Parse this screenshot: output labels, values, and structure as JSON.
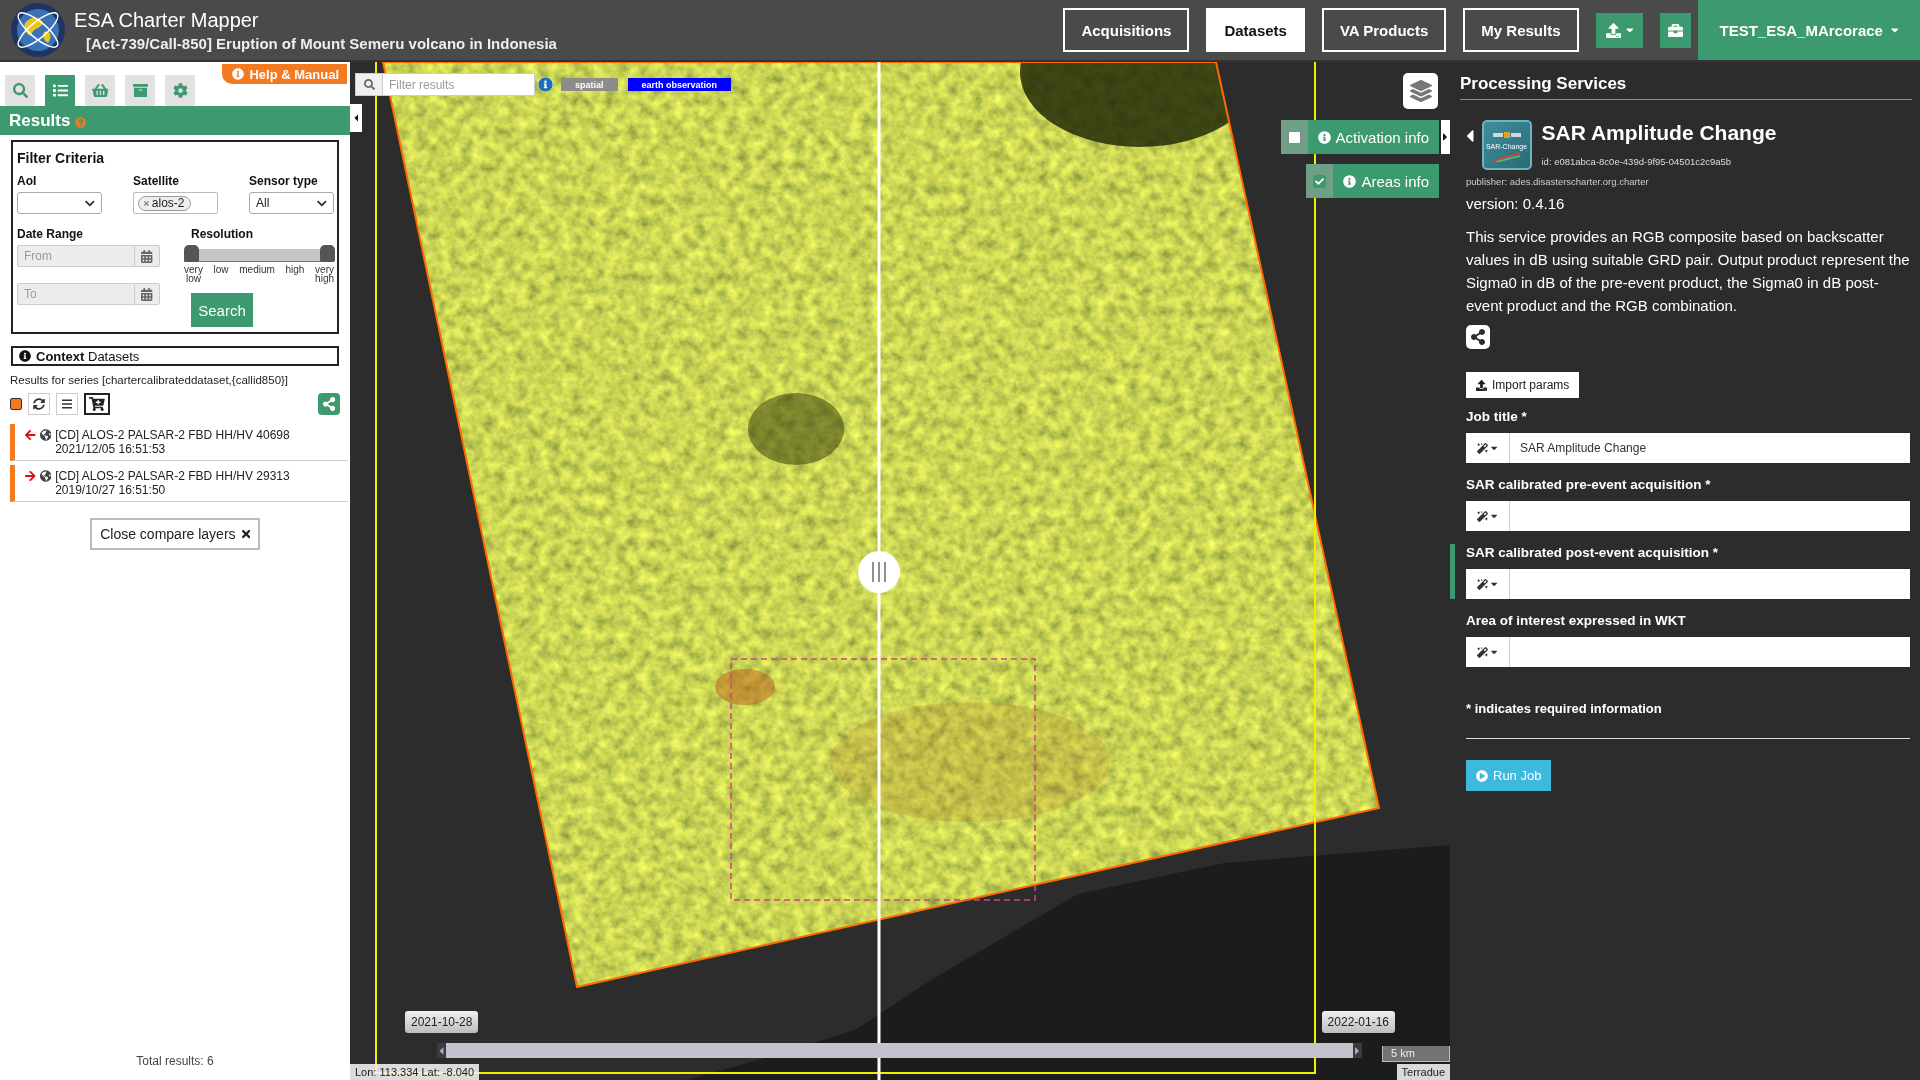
{
  "header": {
    "title": "ESA Charter Mapper",
    "subtitle": "[Act-739/Call-850] Eruption of Mount Semeru volcano in Indonesia",
    "nav": [
      {
        "label": "Acquisitions",
        "selected": false
      },
      {
        "label": "Datasets",
        "selected": true
      },
      {
        "label": "VA Products",
        "selected": false
      },
      {
        "label": "My Results",
        "selected": false
      }
    ],
    "user": "TEST_ESA_MArcorace"
  },
  "sidebar": {
    "tools": [
      {
        "kind": "search",
        "selected": false
      },
      {
        "kind": "list",
        "selected": true
      },
      {
        "kind": "basket",
        "selected": false
      },
      {
        "kind": "archive",
        "selected": false
      },
      {
        "kind": "settings",
        "selected": false
      }
    ],
    "help_tab": "Help & Manual",
    "results_title": "Results",
    "filter": {
      "title": "Filter Criteria",
      "aoi": {
        "label": "AoI"
      },
      "satellite": {
        "label": "Satellite",
        "tags": [
          "alos-2"
        ]
      },
      "sensor_type": {
        "label": "Sensor type",
        "value": "All"
      },
      "date_range": {
        "label": "Date Range",
        "from": {
          "placeholder": "From"
        },
        "to": {
          "placeholder": "To"
        }
      },
      "resolution": {
        "label": "Resolution",
        "level": 1,
        "ticks": [
          "very low",
          "low",
          "medium",
          "high",
          "very high"
        ]
      },
      "search_button": "Search"
    },
    "context": {
      "title": "**Context** Datasets",
      "series": "Results for series [chartercalibrateddataset,{callid850}]",
      "select_all": {
        "checked": true
      },
      "items": [
        {
          "kind": "left",
          "text": "[CD] ALOS-2 PALSAR-2 FBD HH/HV 40698 2021/12/05 16:51:53"
        },
        {
          "kind": "right",
          "text": "[CD] ALOS-2 PALSAR-2 FBD HH/HV 29313 2019/10/27 16:51:50"
        }
      ],
      "close_button": "Close compare layers"
    },
    "total": "Total results: 6"
  },
  "map": {
    "filter": {
      "placeholder": "Filter results"
    },
    "tags": [
      {
        "label": "spatial",
        "color": "#8c8c8c"
      },
      {
        "label": "earth observation",
        "color": "#0000ff"
      }
    ],
    "toggles": [
      {
        "label": "Activation info",
        "checked": false
      },
      {
        "label": "Areas info",
        "checked": true
      }
    ],
    "timeline": {
      "start": "2021-10-28",
      "end": "2022-01-16",
      "level": 1
    },
    "scale": "5 km",
    "coordinates": "Lon: 113.334 Lat: -8.040",
    "attribution": "Terradue"
  },
  "processing": {
    "heading": "Processing Services",
    "service": {
      "icon_label": "SAR-Change",
      "title": "SAR Amplitude Change",
      "id": "id: e081abca-8c0e-439d-9f95-04501c2c9a5b",
      "publisher": "publisher: ades.disasterscharter.org.charter",
      "version": "version: 0.4.16",
      "description": "This service provides an RGB composite based on backscatter values in dB using suitable GRD pair. Output product represent the Sigma0 in dB of the pre-event product, the Sigma0 in dB post-event product and the RGB combination."
    },
    "import_button": "Import params",
    "fields": [
      {
        "label": "Job title *",
        "value": "SAR Amplitude Change",
        "highlighted": false
      },
      {
        "label": "SAR calibrated pre-event acquisition *",
        "highlighted": false
      },
      {
        "label": "SAR calibrated post-event acquisition *",
        "highlighted": true
      },
      {
        "label": "Area of interest expressed in WKT",
        "highlighted": false
      }
    ],
    "required_note": "* indicates required information",
    "run_button": "Run Job"
  }
}
